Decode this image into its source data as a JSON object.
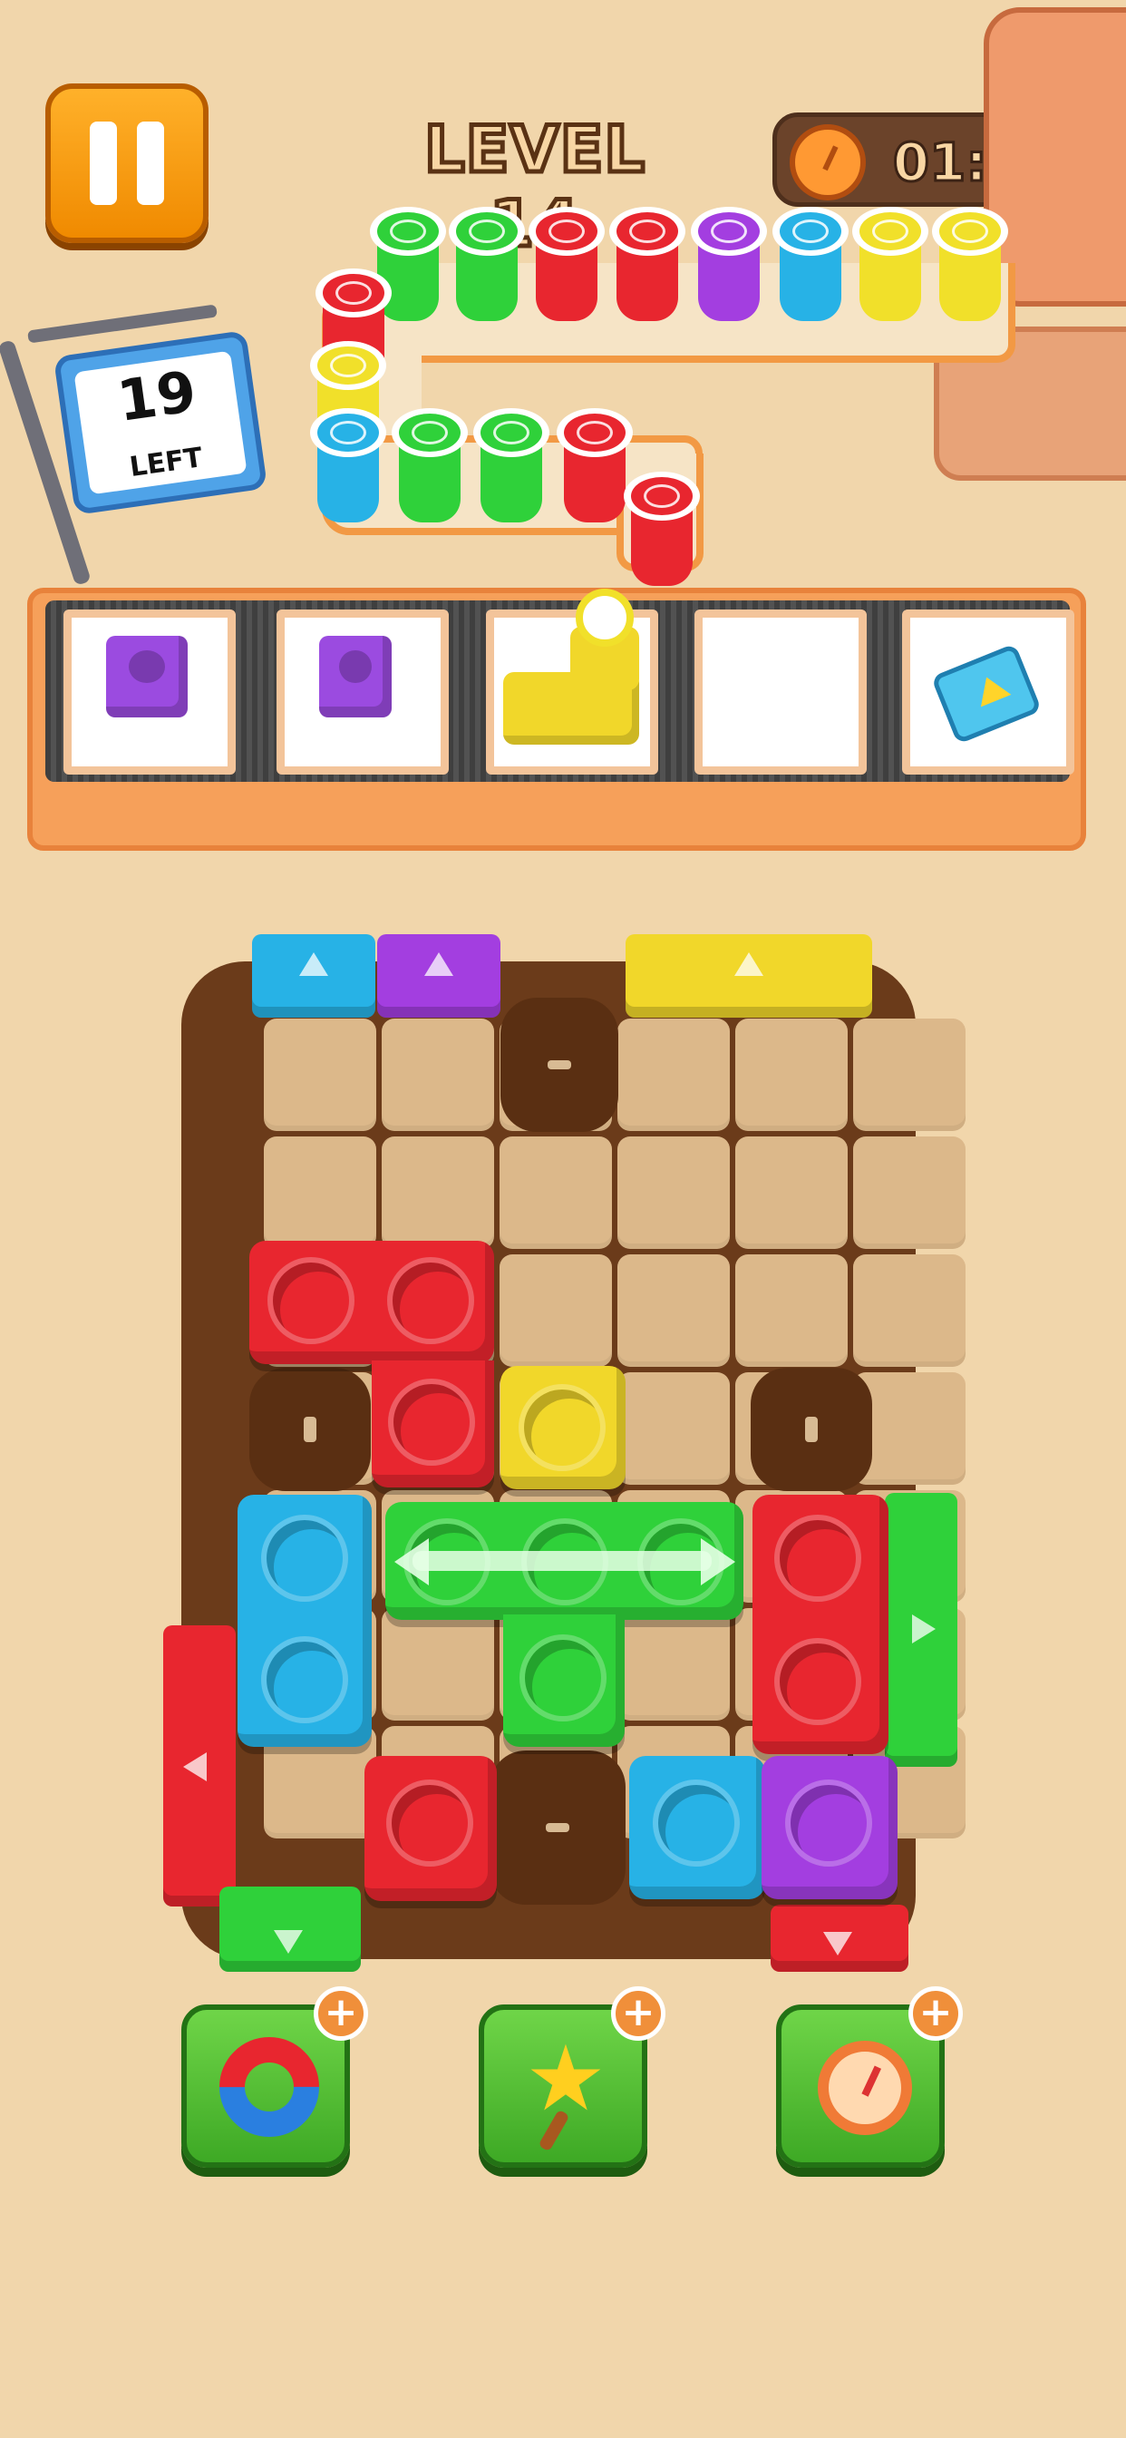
{
  "hud": {
    "level_label": "LEVEL 14",
    "timer_value": "01:37",
    "pause_icon": "pause-icon",
    "stopwatch_icon": "stopwatch-icon"
  },
  "queue_sign": {
    "count": "19",
    "label": "LEFT"
  },
  "cups": [
    {
      "color": "#2fd13a",
      "art": "leaf"
    },
    {
      "color": "#2fd13a",
      "art": "leaf"
    },
    {
      "color": "#e8262f",
      "art": "tulip"
    },
    {
      "color": "#e8262f",
      "art": "tulip"
    },
    {
      "color": "#a33ee0",
      "art": "heart"
    },
    {
      "color": "#27b2e6",
      "art": "leaf"
    },
    {
      "color": "#f1e02a",
      "art": "swirl"
    },
    {
      "color": "#f1e02a",
      "art": "swirl"
    },
    {
      "color": "#e8262f",
      "art": "tulip"
    },
    {
      "color": "#f1e02a",
      "art": "swirl"
    },
    {
      "color": "#27b2e6",
      "art": "leaf"
    },
    {
      "color": "#2fd13a",
      "art": "leaf"
    },
    {
      "color": "#2fd13a",
      "art": "leaf"
    },
    {
      "color": "#e8262f",
      "art": "tulip"
    },
    {
      "color": "#e8262f",
      "art": "tulip"
    }
  ],
  "tray_slots": [
    {
      "content": "purple-single-block"
    },
    {
      "content": "purple-single-block"
    },
    {
      "content": "yellow-l-block-with-cup"
    },
    {
      "content": "empty"
    },
    {
      "content": "ad-card-icon"
    }
  ],
  "colors": {
    "red": "#e8262f",
    "blue": "#27b2e6",
    "green": "#2fd13a",
    "yellow": "#f1e02a",
    "purple": "#a33ee0"
  },
  "powerups": [
    {
      "name": "magnet",
      "icon": "magnet-icon",
      "plus": "+"
    },
    {
      "name": "star-wand",
      "icon": "star-wand-icon",
      "plus": "+"
    },
    {
      "name": "freeze-timer",
      "icon": "stopwatch-icon",
      "plus": "+"
    }
  ]
}
